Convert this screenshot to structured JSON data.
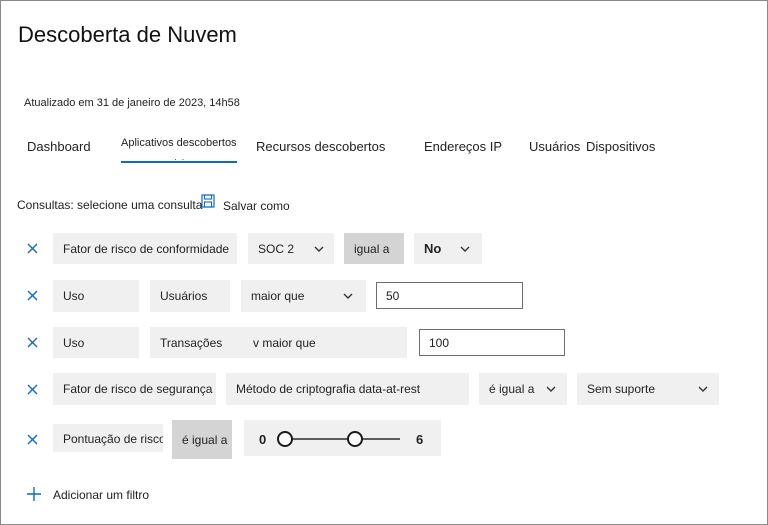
{
  "page": {
    "title": "Descoberta de Nuvem",
    "updated": "Atualizado em 31 de janeiro de 2023, 14h58"
  },
  "tabs": [
    {
      "label": "Dashboard"
    },
    {
      "label": "Aplicativos descobertos"
    },
    {
      "label": "Recursos descobertos"
    },
    {
      "label": "Endereços IP"
    },
    {
      "label": "Usuários"
    },
    {
      "label": "Dispositivos"
    }
  ],
  "tab_dots": "· ·",
  "queries": {
    "label": "Consultas: selecione uma consulta",
    "save_label": "Salvar como"
  },
  "filters": [
    {
      "field": "Fator de risco de conformidade",
      "sub": "SOC 2",
      "op": "igual a",
      "value": "No"
    },
    {
      "field": "Uso",
      "sub": "Usuários",
      "op": "maior que",
      "value": "50"
    },
    {
      "field": "Uso",
      "sub": "Transações",
      "op": "v maior que",
      "value": "100"
    },
    {
      "field": "Fator de risco de segurança",
      "sub": "Método de criptografia data-at-rest",
      "op": "é igual a",
      "value": "Sem suporte"
    },
    {
      "field": "Pontuação de risco",
      "op": "é igual a",
      "min": "0",
      "max": "6",
      "range_low": 0,
      "range_high": 6
    }
  ],
  "add_filter": "Adicionar um filtro",
  "icons": {
    "remove": "close-icon",
    "save": "floppy-disk-icon",
    "add": "plus-icon",
    "dropdown": "chevron-down-icon"
  },
  "colors": {
    "accent": "#0f6cbd",
    "field_bg": "#f0f0f0",
    "operator_bg": "#d4d4d4"
  }
}
